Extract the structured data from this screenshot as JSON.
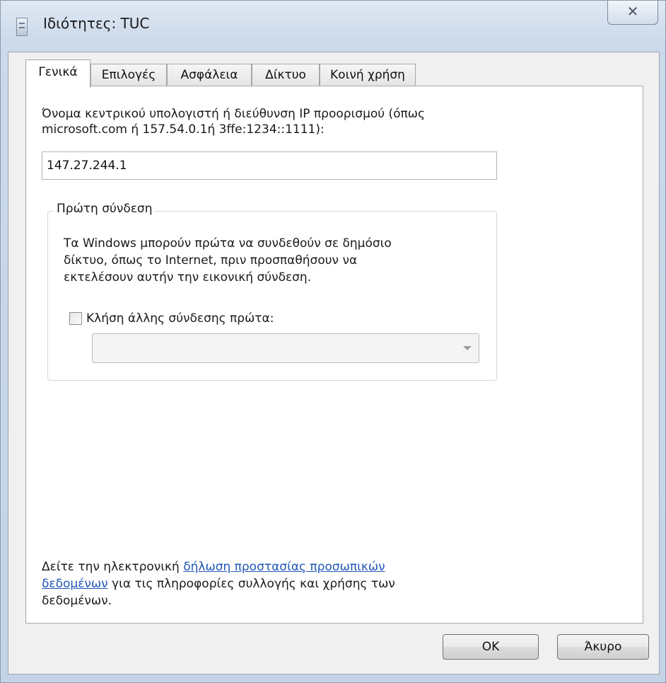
{
  "window": {
    "title": "Ιδιότητες: TUC",
    "close_glyph": "✕"
  },
  "tabs": [
    {
      "label": "Γενικά",
      "active": true
    },
    {
      "label": "Επιλογές",
      "active": false
    },
    {
      "label": "Ασφάλεια",
      "active": false
    },
    {
      "label": "Δίκτυο",
      "active": false
    },
    {
      "label": "Κοινή χρήση",
      "active": false
    }
  ],
  "general": {
    "host_label_line1": "Όνομα κεντρικού υπολογιστή ή διεύθυνση IP προορισμού (όπως",
    "host_label_line2": "microsoft.com ή 157.54.0.1ή 3ffe:1234::1111):",
    "host_value": "147.27.244.1",
    "first_connect": {
      "legend": "Πρώτη σύνδεση",
      "desc_line1": "Τα Windows μπορούν πρώτα να συνδεθούν σε δημόσιο",
      "desc_line2": "δίκτυο, όπως το Internet, πριν προσπαθήσουν να",
      "desc_line3": "εκτελέσουν αυτήν την εικονική σύνδεση.",
      "checkbox_label": "Κλήση άλλης σύνδεσης πρώτα:",
      "checkbox_checked": false,
      "dropdown_value": ""
    },
    "privacy": {
      "prefix": "Δείτε την ηλεκτρονική ",
      "link_part1": "δήλωση προστασίας προσωπικών",
      "link_part2": "δεδομένων",
      "suffix": " για τις πληροφορίες συλλογής και χρήσης των",
      "line3": "δεδομένων."
    }
  },
  "buttons": {
    "ok": "OK",
    "cancel": "Άκυρο"
  },
  "colors": {
    "link": "#2056b8",
    "panel_bg": "#ffffff",
    "dialog_bg": "#f0f0f0"
  }
}
